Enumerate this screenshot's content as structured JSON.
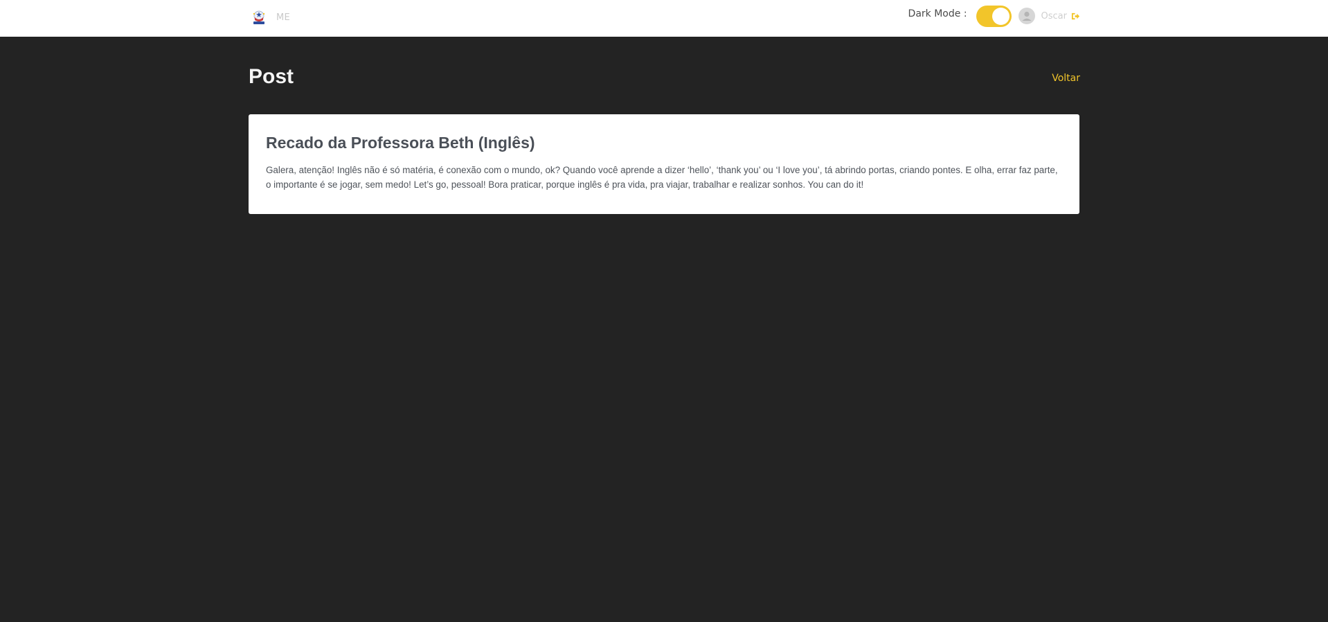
{
  "header": {
    "brand_text": "ME",
    "dark_mode_label": "Dark Mode :",
    "dark_mode_enabled": true,
    "username": "Oscar",
    "accent_color": "#f2c52a",
    "logout_icon": "sign-out-icon",
    "avatar_icon": "user-icon",
    "logo_icon": "school-crest-icon"
  },
  "page": {
    "title": "Post",
    "back_label": "Voltar"
  },
  "post": {
    "title": "Recado da Professora Beth (Inglês)",
    "body": "Galera, atenção! Inglês não é só matéria, é conexão com o mundo, ok? Quando você aprende a dizer ‘hello’, ‘thank you’ ou ‘I love you’, tá abrindo portas, criando pontes. E olha, errar faz parte, o importante é se jogar, sem medo! Let’s go, pessoal! Bora praticar, porque inglês é pra vida, pra viajar, trabalhar e realizar sonhos. You can do it!"
  }
}
